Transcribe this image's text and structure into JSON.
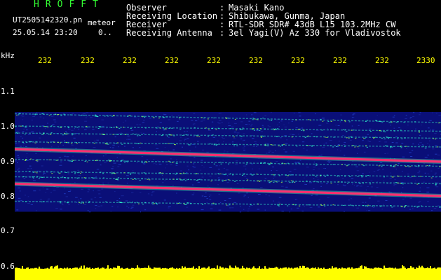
{
  "header": {
    "title": "HROFFT",
    "filename": "UT2505142320.pn",
    "mode": "meteor",
    "datetime": "25.05.14 23:20",
    "counter": "0..",
    "title_color": "#33ff33",
    "text_color": "#ffffff",
    "tick_color": "#ffff00"
  },
  "info": {
    "rows": [
      {
        "label": "Observer",
        "value": "Masaki Kano"
      },
      {
        "label": "Receiving Location",
        "value": "Shibukawa, Gunma, Japan"
      },
      {
        "label": "Receiver",
        "value": "RTL-SDR SDR# 43dB L15 103.2MHz CW"
      },
      {
        "label": "Receiving Antenna",
        "value": "3el Yagi(V) Az 330 for Vladivostok"
      }
    ],
    "separator": ":"
  },
  "axes": {
    "y_unit": "kHz",
    "y_ticks": [
      {
        "label": "1.1",
        "value": 1.1
      },
      {
        "label": "1.0",
        "value": 1.0
      },
      {
        "label": "0.9",
        "value": 0.9
      },
      {
        "label": "0.8",
        "value": 0.8
      },
      {
        "label": "0.7",
        "value": 0.7
      },
      {
        "label": "0.6",
        "value": 0.6
      }
    ],
    "y_range": [
      0.58,
      1.18
    ],
    "x_ticks": [
      "232",
      "232",
      "232",
      "232",
      "232",
      "232",
      "232",
      "232",
      "232",
      "2330"
    ],
    "x_range": [
      0,
      10
    ]
  },
  "spectrogram": {
    "noise_band_khz": [
      0.755,
      1.04
    ],
    "strong_carriers": [
      {
        "start_khz": 0.934,
        "end_khz": 0.898,
        "color": "#ff3070"
      },
      {
        "start_khz": 0.835,
        "end_khz": 0.8,
        "color": "#ff3070"
      }
    ],
    "weak_lines": [
      {
        "start_khz": 1.035,
        "end_khz": 1.01
      },
      {
        "start_khz": 1.0,
        "end_khz": 0.985
      },
      {
        "start_khz": 0.98,
        "end_khz": 0.965
      },
      {
        "start_khz": 0.955,
        "end_khz": 0.94
      },
      {
        "start_khz": 0.905,
        "end_khz": 0.885
      },
      {
        "start_khz": 0.87,
        "end_khz": 0.855
      },
      {
        "start_khz": 0.855,
        "end_khz": 0.835
      },
      {
        "start_khz": 0.785,
        "end_khz": 0.77
      }
    ],
    "background_color": "#000000",
    "noise_color": "#0a0f78",
    "signal_color": "#2fd0c0",
    "level_bar_color": "#ffff00"
  }
}
